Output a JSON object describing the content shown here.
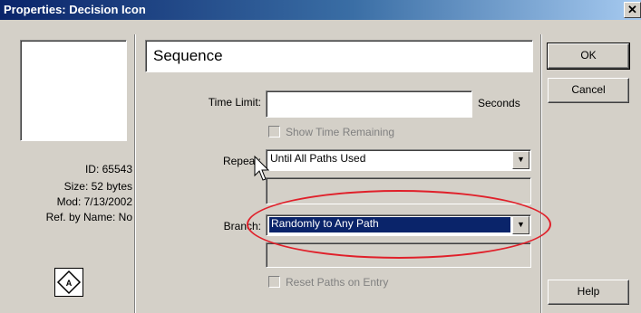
{
  "window": {
    "title": "Properties: Decision Icon",
    "close_label": "✕"
  },
  "icon_info": {
    "id": "ID: 65543",
    "size": "Size: 52 bytes",
    "modified": "Mod: 7/13/2002",
    "ref_by_name": "Ref. by Name: No",
    "icon_glyph": "decision-diamond-icon"
  },
  "form": {
    "icon_title_value": "Sequence",
    "time_limit": {
      "label": "Time Limit:",
      "value": "",
      "unit": "Seconds"
    },
    "show_time_remaining": {
      "label": "Show Time Remaining",
      "checked": false,
      "enabled": false
    },
    "repeat": {
      "label": "Repeat:",
      "value": "Until All Paths Used"
    },
    "branch": {
      "label": "Branch:",
      "value": "Randomly to Any Path"
    },
    "reset_paths": {
      "label": "Reset Paths on Entry",
      "checked": false,
      "enabled": false
    }
  },
  "buttons": {
    "ok": "OK",
    "cancel": "Cancel",
    "help": "Help"
  },
  "colors": {
    "titlebar": "#0a246a",
    "selection": "#0a246a",
    "highlight_ellipse": "#e0202a",
    "dialog_bg": "#d4d0c8"
  }
}
